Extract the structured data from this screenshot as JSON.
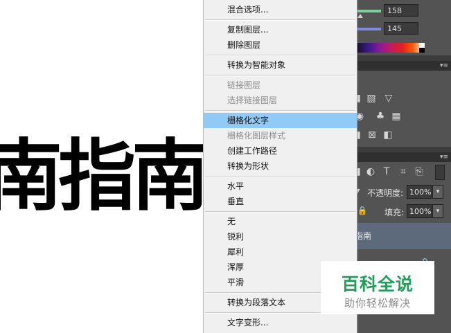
{
  "canvas": {
    "text": "南指南"
  },
  "panel": {
    "sliders": [
      {
        "value": "158",
        "color": "#7ed09a"
      },
      {
        "value": "145",
        "color": "#7f8cd3"
      }
    ],
    "layers": {
      "opacity_label": "不透明度:",
      "opacity_value": "100%",
      "fill_label": "填充:",
      "fill_value": "100%",
      "layer_name": "指南"
    }
  },
  "context_menu": {
    "highlight_color": "#91c9f7",
    "items": [
      {
        "label": "混合选项...",
        "enabled": true
      },
      {
        "label": "复制图层...",
        "enabled": true
      },
      {
        "label": "删除图层",
        "enabled": true
      },
      {
        "label": "转换为智能对象",
        "enabled": true
      },
      {
        "label": "链接图层",
        "enabled": false
      },
      {
        "label": "选择链接图层",
        "enabled": false
      },
      {
        "label": "栅格化文字",
        "enabled": true,
        "highlighted": true
      },
      {
        "label": "栅格化图层样式",
        "enabled": false
      },
      {
        "label": "创建工作路径",
        "enabled": true
      },
      {
        "label": "转换为形状",
        "enabled": true
      },
      {
        "label": "水平",
        "enabled": true
      },
      {
        "label": "垂直",
        "enabled": true
      },
      {
        "label": "无",
        "enabled": true
      },
      {
        "label": "锐利",
        "enabled": true
      },
      {
        "label": "犀利",
        "enabled": true
      },
      {
        "label": "浑厚",
        "enabled": true
      },
      {
        "label": "平滑",
        "enabled": true
      },
      {
        "label": "转换为段落文本",
        "enabled": true
      },
      {
        "label": "文字变形...",
        "enabled": true
      }
    ]
  },
  "watermark": {
    "title": "百科全说",
    "subtitle": "助你轻松解决",
    "title_color": "#1fa05a"
  }
}
